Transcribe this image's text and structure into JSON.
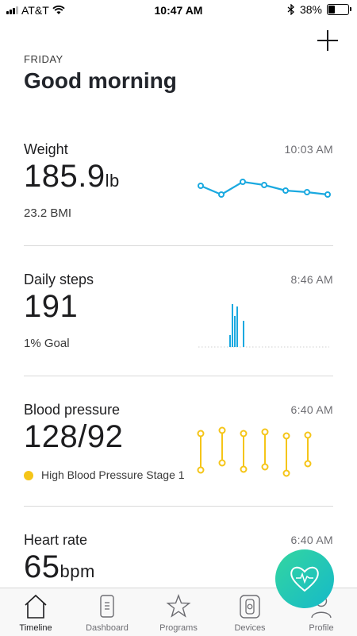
{
  "status_bar": {
    "carrier": "AT&T",
    "time": "10:47 AM",
    "battery": "38%",
    "battery_level": 0.38
  },
  "header": {
    "day": "FRIDAY",
    "greeting": "Good morning"
  },
  "cards": {
    "weight": {
      "title": "Weight",
      "time": "10:03 AM",
      "value": "185.9",
      "unit": "lb",
      "sub": "23.2 BMI"
    },
    "steps": {
      "title": "Daily steps",
      "time": "8:46 AM",
      "value": "191",
      "sub": "1% Goal"
    },
    "bp": {
      "title": "Blood pressure",
      "time": "6:40 AM",
      "value": "128/92",
      "sub": "High Blood Pressure Stage 1"
    },
    "heart": {
      "title": "Heart rate",
      "time": "6:40 AM",
      "value": "65",
      "unit": "bpm"
    }
  },
  "tabs": [
    "Timeline",
    "Dashboard",
    "Programs",
    "Devices",
    "Profile"
  ],
  "colors": {
    "weight_line": "#1aa9e0",
    "steps_bar": "#1aa9e0",
    "bp_marker": "#f5c518",
    "fab_start": "#33d6a0",
    "fab_end": "#16b9c9"
  },
  "icons": {
    "add": "plus-icon",
    "fab": "heart-icon",
    "tabs": [
      "home-icon",
      "dashboard-icon",
      "star-icon",
      "watch-icon",
      "person-icon"
    ]
  }
}
